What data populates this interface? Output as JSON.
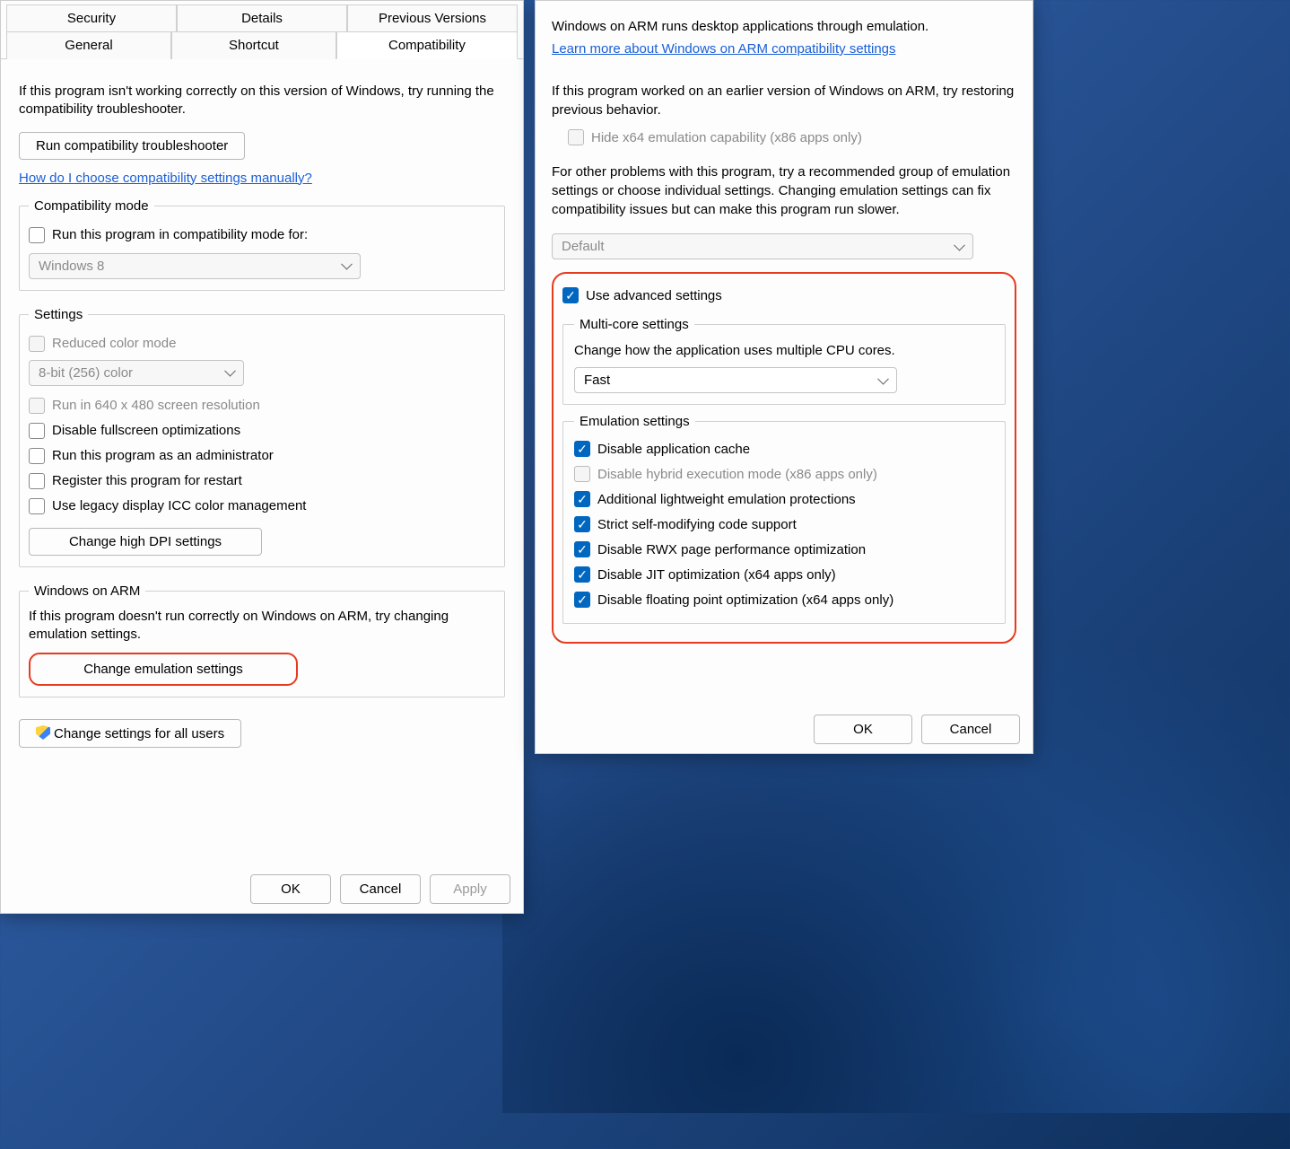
{
  "left_dialog": {
    "tabs_row1": [
      "Security",
      "Details",
      "Previous Versions"
    ],
    "tabs_row2": [
      "General",
      "Shortcut",
      "Compatibility"
    ],
    "intro": "If this program isn't working correctly on this version of Windows, try running the compatibility troubleshooter.",
    "run_troubleshooter_btn": "Run compatibility troubleshooter",
    "manual_link": "How do I choose compatibility settings manually?",
    "compat_mode": {
      "legend": "Compatibility mode",
      "checkbox_label": "Run this program in compatibility mode for:",
      "os_selected": "Windows 8"
    },
    "settings": {
      "legend": "Settings",
      "reduced_color": "Reduced color mode",
      "color_select": "8-bit (256) color",
      "run_640": "Run in 640 x 480 screen resolution",
      "disable_fullscreen": "Disable fullscreen optimizations",
      "run_admin": "Run this program as an administrator",
      "register_restart": "Register this program for restart",
      "legacy_icc": "Use legacy display ICC color management",
      "high_dpi_btn": "Change high DPI settings"
    },
    "arm": {
      "legend": "Windows on ARM",
      "desc": "If this program doesn't run correctly on Windows on ARM, try changing emulation settings.",
      "change_btn": "Change emulation settings"
    },
    "all_users_btn": "Change settings for all users",
    "footer": {
      "ok": "OK",
      "cancel": "Cancel",
      "apply": "Apply"
    }
  },
  "right_dialog": {
    "intro1": "Windows on ARM runs desktop applications through emulation.",
    "learn_link": "Learn more about Windows on ARM compatibility settings",
    "intro2": "If this program worked on an earlier version of Windows on ARM, try restoring previous behavior.",
    "hide_x64": "Hide x64 emulation capability (x86 apps only)",
    "intro3": "For other problems with this program, try a recommended group of emulation settings or choose individual settings.  Changing emulation settings can fix compatibility issues but can make this program run slower.",
    "preset_select": "Default",
    "use_advanced": "Use advanced settings",
    "multi_core": {
      "legend": "Multi-core settings",
      "desc": "Change how the application uses multiple CPU cores.",
      "selected": "Fast"
    },
    "emulation": {
      "legend": "Emulation settings",
      "disable_cache": "Disable application cache",
      "disable_hybrid": "Disable hybrid execution mode (x86 apps only)",
      "additional_protections": "Additional lightweight emulation protections",
      "strict_smc": "Strict self-modifying code support",
      "disable_rwx": "Disable RWX page performance optimization",
      "disable_jit": "Disable JIT optimization (x64 apps only)",
      "disable_fp": "Disable floating point optimization (x64 apps only)"
    },
    "footer": {
      "ok": "OK",
      "cancel": "Cancel"
    }
  }
}
